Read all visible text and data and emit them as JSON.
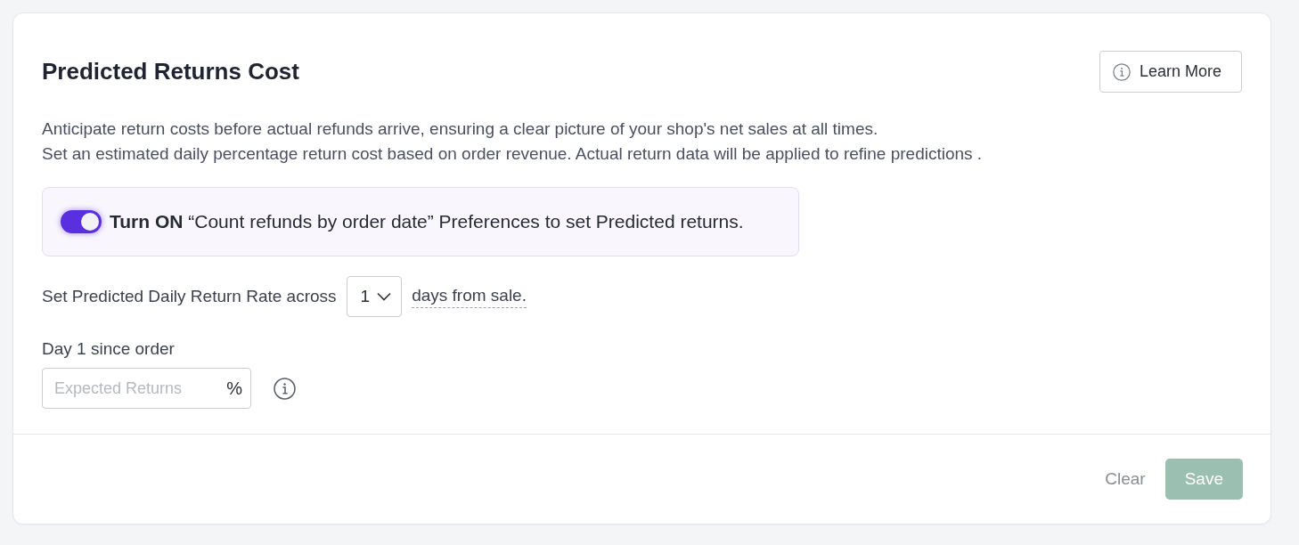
{
  "card": {
    "title": "Predicted Returns Cost",
    "learn_more_button": "Learn More",
    "description": [
      "Anticipate return costs before actual refunds arrive, ensuring a clear picture of your shop's net sales at all times.",
      "Set an estimated daily percentage return cost based on order revenue. Actual return data will be applied to refine predictions ."
    ]
  },
  "notice": {
    "toggle_on": true,
    "text": "**Turn ON** “Count refunds by order date” Preferences to set Predicted returns."
  },
  "return_window": {
    "label": "Set Predicted Daily Return Rate across",
    "select_value": "1",
    "suffix": "days from sale."
  },
  "days": [
    {
      "label": "Day 1 since order",
      "placeholder": "Expected Returns",
      "unit": "%"
    }
  ],
  "footer": {
    "buttons": [
      {
        "label": "Clear",
        "kind": "link",
        "disabled": false
      },
      {
        "label": "Save",
        "kind": "primary",
        "disabled": true
      }
    ]
  }
}
